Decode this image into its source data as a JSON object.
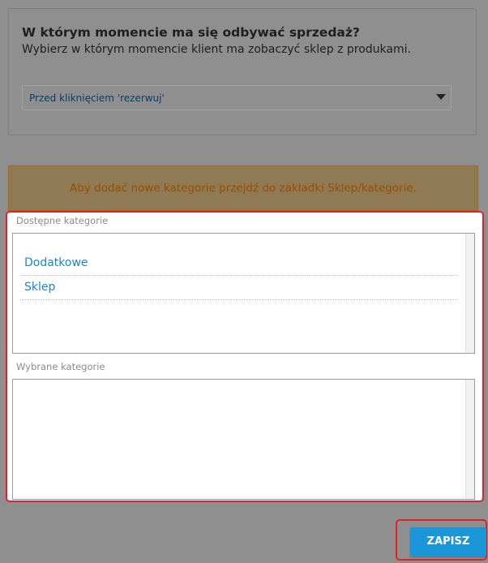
{
  "sale_timing": {
    "title": "W którym momencie ma się odbywać sprzedaż?",
    "subtitle": "Wybierz w którym momencie klient ma zobaczyć sklep z produkami.",
    "select": {
      "selected": "Przed kliknięciem 'rezerwuj'",
      "arrow_icon": "caret-down-icon"
    }
  },
  "notice": {
    "text": "Aby dodać nowe kategorie przejdź do zakładki Sklep/kategorie."
  },
  "categories": {
    "available_label": "Dostępne kategorie",
    "available_items": [
      {
        "label": "Dodatkowe"
      },
      {
        "label": "Sklep"
      }
    ],
    "selected_label": "Wybrane kategorie",
    "selected_items": []
  },
  "actions": {
    "save_label": "ZAPISZ"
  },
  "colors": {
    "overlay": "#8f8f8f",
    "highlight_border": "#e0202b",
    "link_blue": "#1a86c8",
    "button_blue": "#1b96d8",
    "notice_text": "#9b4e00"
  }
}
